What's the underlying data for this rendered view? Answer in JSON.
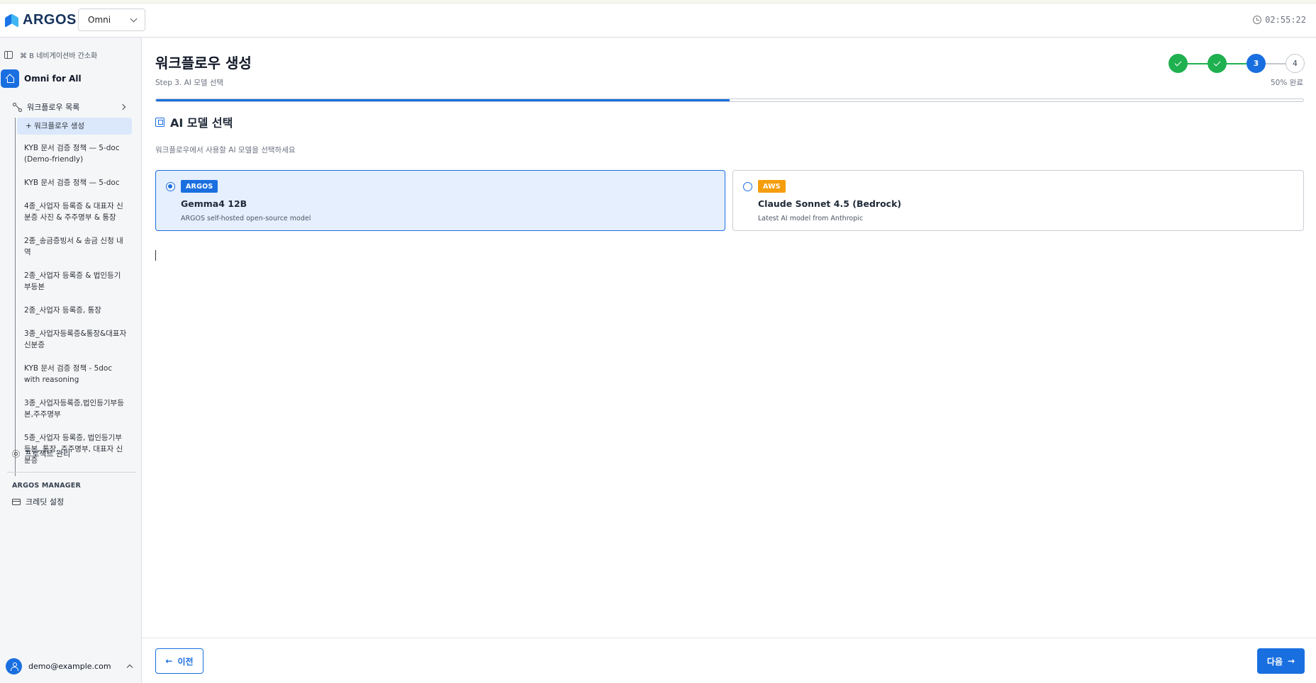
{
  "header": {
    "brand": "ARGOS",
    "workspace": "Omni",
    "time": "02:55:22"
  },
  "sidebar": {
    "toggle_label": "⌘ B 네비게이션바 간소화",
    "project_name": "Omni for All",
    "workflow_list_label": "워크플로우 목록",
    "workflows": [
      "+ 워크플로우 생성",
      "KYB 문서 검증 정책 — 5-doc (Demo-friendly)",
      "KYB 문서 검증 정책 — 5-doc",
      "4종_사업자 등록증 & 대표자 신분증 사진 & 주주명부 & 통장",
      "2종_송금증빙서 & 송금 신청 내역",
      "2종_사업자 등록증 & 법인등기부등본",
      "2종_사업자 등록증, 통장",
      "3종_사업자등록증&통장&대표자신분증",
      "KYB 문서 검증 정책 - 5doc with reasoning",
      "3종_사업자등록증,법인등기부등본,주주명부",
      "5종_사업자 등록증, 법인등기부등본, 통장, 주주명부, 대표자 신분증"
    ],
    "project_mgmt": "프로젝트 관리",
    "manager_title": "ARGOS MANAGER",
    "credit_settings": "크레딧 설정",
    "user_email": "demo@example.com"
  },
  "main": {
    "title": "워크플로우 생성",
    "step_label": "Step 3. AI 모델 선택",
    "steps": [
      "1",
      "2",
      "3",
      "4"
    ],
    "current_step": 3,
    "progress_text": "50% 완료",
    "progress": 0.5,
    "section_title": "AI 모델 선택",
    "section_desc": "워크플로우에서 사용할 AI 모델을 선택하세요",
    "models": [
      {
        "badge": "ARGOS",
        "name": "Gemma4 12B",
        "desc": "ARGOS self-hosted open-source model",
        "selected": true
      },
      {
        "badge": "AWS",
        "name": "Claude Sonnet 4.5 (Bedrock)",
        "desc": "Latest AI model from Anthropic",
        "selected": false
      }
    ],
    "prev_label": "이전",
    "next_label": "다음"
  },
  "colors": {
    "primary": "#1a6fe0",
    "success": "#1fb04f",
    "aws": "#f59e0b"
  }
}
